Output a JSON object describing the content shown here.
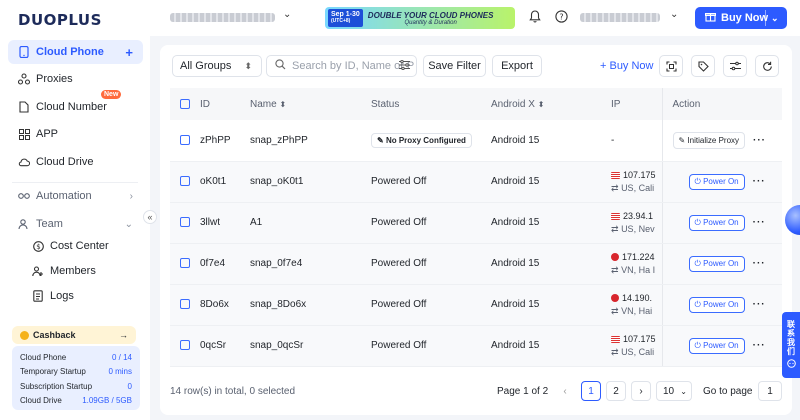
{
  "brand": {
    "logo_text": "DUOPLUS",
    "accent": "#2d5bff"
  },
  "sidebar": {
    "items": [
      {
        "label": "Cloud Phone",
        "icon": "phone-icon",
        "active": true
      },
      {
        "label": "Proxies",
        "icon": "proxy-icon"
      },
      {
        "label": "Cloud Number",
        "icon": "sim-icon",
        "badge": "New"
      },
      {
        "label": "APP",
        "icon": "grid-icon"
      },
      {
        "label": "Cloud Drive",
        "icon": "cloud-icon"
      }
    ],
    "automation_label": "Automation",
    "team_label": "Team",
    "team_items": [
      {
        "label": "Cost Center",
        "icon": "dollar-icon"
      },
      {
        "label": "Members",
        "icon": "members-icon"
      },
      {
        "label": "Logs",
        "icon": "logs-icon"
      }
    ],
    "cashback_label": "Cashback",
    "stats": [
      {
        "label": "Cloud Phone",
        "value": "0 / 14"
      },
      {
        "label": "Temporary Startup",
        "value": "0 mins"
      },
      {
        "label": "Subscription Startup",
        "value": "0"
      },
      {
        "label": "Cloud Drive",
        "value": "1.09GB / 5GB"
      }
    ]
  },
  "topbar": {
    "banner_date": "Sep 1-30",
    "banner_tz": "(UTC+8)",
    "banner_text": "DOUBLE YOUR CLOUD PHONES",
    "banner_sub": "Quantity & Duration",
    "buy_now": "Buy Now"
  },
  "toolbar": {
    "group_select": "All Groups",
    "search_placeholder": "Search by ID, Name or P",
    "save_filter": "Save Filter",
    "export": "Export",
    "buy_now": "+ Buy Now"
  },
  "table": {
    "headers": [
      "ID",
      "Name",
      "Status",
      "Android X",
      "IP",
      "Action"
    ],
    "rows": [
      {
        "id": "zPhPP",
        "name": "snap_zPhPP",
        "status": "No Proxy Configured",
        "android": "Android 15",
        "ip": "-",
        "loc": "",
        "flag": "",
        "action": "Initialize Proxy"
      },
      {
        "id": "oK0t1",
        "name": "snap_oK0t1",
        "status": "Powered Off",
        "android": "Android 15",
        "ip": "107.175",
        "loc": "US, Cali",
        "flag": "us",
        "action": "Power On"
      },
      {
        "id": "3llwt",
        "name": "A1",
        "status": "Powered Off",
        "android": "Android 15",
        "ip": "23.94.1",
        "loc": "US, Nev",
        "flag": "us",
        "action": "Power On"
      },
      {
        "id": "0f7e4",
        "name": "snap_0f7e4",
        "status": "Powered Off",
        "android": "Android 15",
        "ip": "171.224",
        "loc": "VN, Ha I",
        "flag": "vn",
        "action": "Power On"
      },
      {
        "id": "8Do6x",
        "name": "snap_8Do6x",
        "status": "Powered Off",
        "android": "Android 15",
        "ip": "14.190.",
        "loc": "VN, Hai",
        "flag": "vn",
        "action": "Power On"
      },
      {
        "id": "0qcSr",
        "name": "snap_0qcSr",
        "status": "Powered Off",
        "android": "Android 15",
        "ip": "107.175",
        "loc": "US, Cali",
        "flag": "us",
        "action": "Power On"
      }
    ]
  },
  "footer": {
    "summary": "14 row(s) in total, 0 selected",
    "page_of": "Page 1 of 2",
    "pages": [
      "1",
      "2"
    ],
    "page_size": "10",
    "goto_label": "Go to page",
    "goto_value": "1"
  },
  "contact_label": "联系我们"
}
